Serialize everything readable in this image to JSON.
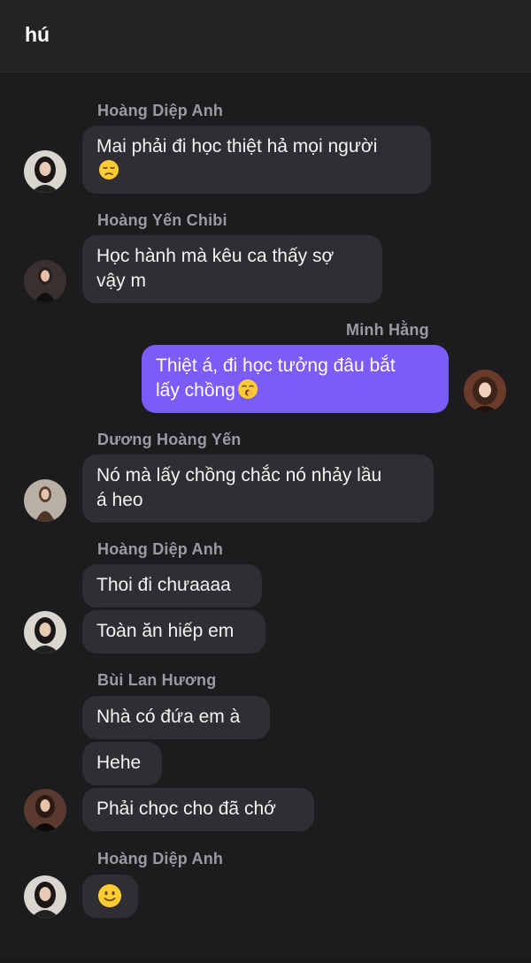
{
  "header": {
    "title": "hú"
  },
  "messages": [
    {
      "sender": "Hoàng Diệp Anh",
      "text": "Mai phải đi học thiệt hả mọi người"
    },
    {
      "sender": "Hoàng Yến Chibi",
      "text_line1": "Học hành mà kêu ca thấy sợ",
      "text_line2": "vậy m"
    },
    {
      "sender": "Minh Hằng",
      "text_line1": "Thiệt á, đi học tưởng đâu bắt",
      "text_line2": "lấy chồng"
    },
    {
      "sender": "Dương Hoàng Yến",
      "text_line1": "Nó mà lấy chồng chắc nó nhảy lầu",
      "text_line2": "á heo"
    },
    {
      "sender": "Hoàng Diệp Anh",
      "text1": "Thoi đi chưaaaa",
      "text2": "Toàn ăn hiếp em"
    },
    {
      "sender": "Bùi Lan Hương",
      "text1": "Nhà có đứa em à",
      "text2": "Hehe",
      "text3": "Phải chọc cho đã chớ"
    },
    {
      "sender": "Hoàng Diệp Anh"
    }
  ],
  "emojis": {
    "disappointed": "disappointed-face-icon",
    "yawn": "yawning-face-icon",
    "smile": "slightly-smiling-face-icon"
  },
  "colors": {
    "background": "#1c1b1e",
    "incoming_bubble": "#2f2e32",
    "outgoing_bubble": "#7b5cf6",
    "sender_name": "#9c9aa0"
  }
}
